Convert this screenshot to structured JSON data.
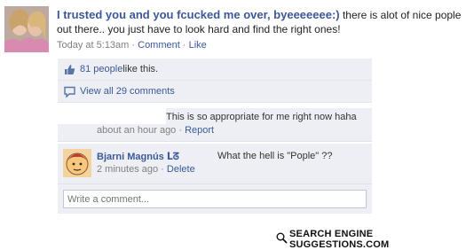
{
  "post": {
    "author": "I trusted you and you fcucked me over, byeeeeeee:)",
    "text": " there is alot of nice pople out there.. you just have to look hard and find the right ones!",
    "timestamp": "Today at 5:13am",
    "comment_label": "Comment",
    "like_label": "Like",
    "separator": " · "
  },
  "ufi": {
    "likes_link": "81 people",
    "likes_suffix": " like this.",
    "view_all": "View all 29 comments",
    "comments": [
      {
        "text": "This is so appropriate for me right now haha",
        "time": "about an hour ago",
        "action": "Report"
      },
      {
        "author": "Bjarni Magnús ᒪᘔ",
        "text": "What the hell is \"Pople\" ??",
        "time": "2 minutes ago",
        "action": "Delete"
      }
    ],
    "write_placeholder": "Write a comment..."
  },
  "watermark": "SEARCH ENGINE SUGGESTIONS.COM",
  "colors": {
    "link": "#3b5998",
    "ufi_bg": "#edeff4",
    "meta": "#808080"
  },
  "icons": [
    "thumbs-up-icon",
    "comment-bubble-icon",
    "magnifier-icon"
  ]
}
